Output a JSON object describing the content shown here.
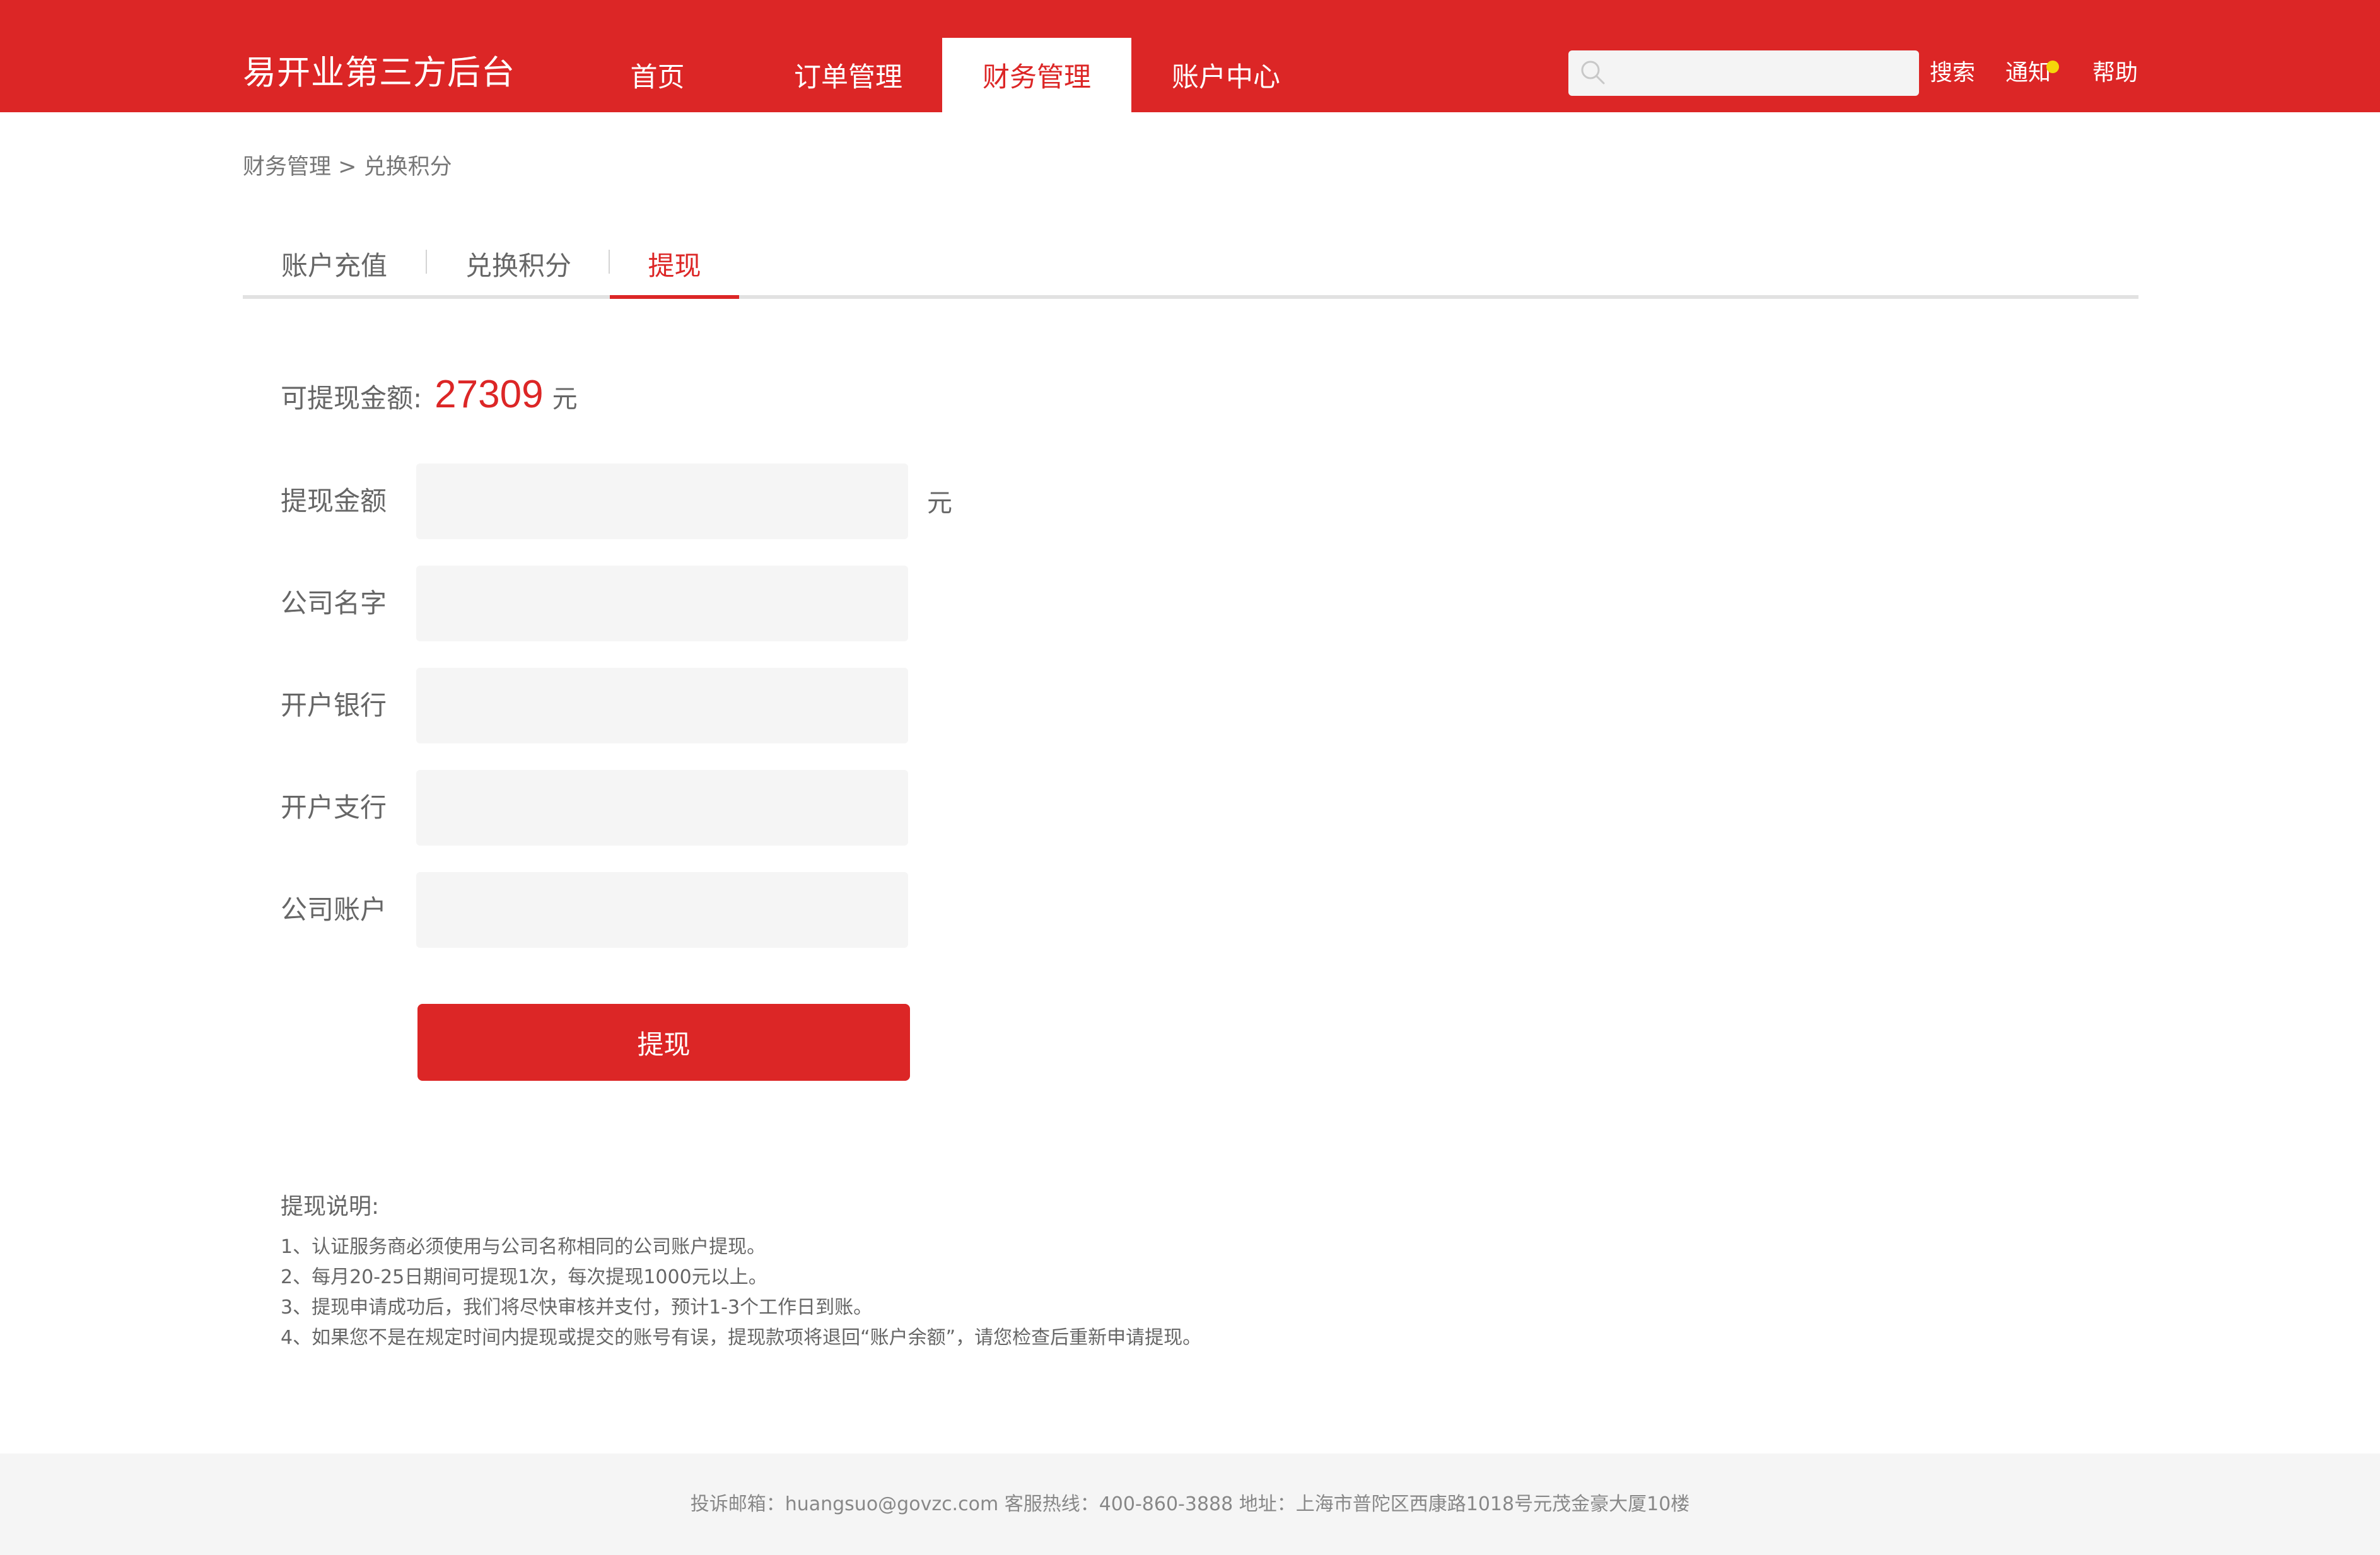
{
  "header": {
    "brand": "易开业第三方后台",
    "nav": [
      {
        "label": "首页",
        "active": false
      },
      {
        "label": "订单管理",
        "active": false
      },
      {
        "label": "财务管理",
        "active": true
      },
      {
        "label": "账户中心",
        "active": false
      }
    ],
    "search": {
      "placeholder": "",
      "value": "",
      "icon": "search-icon"
    },
    "search_label": "搜索",
    "notify_label": "通知",
    "help_label": "帮助",
    "accent_color": "#dc2626",
    "notify_dot_color": "#f5d70a"
  },
  "breadcrumb": "财务管理 > 兑换积分",
  "tabs": [
    {
      "label": "账户充值",
      "active": false
    },
    {
      "label": "兑换积分",
      "active": false
    },
    {
      "label": "提现",
      "active": true
    }
  ],
  "withdraw": {
    "available_label": "可提现金额:",
    "available_amount": "27309",
    "available_unit": "元",
    "fields": [
      {
        "label": "提现金额",
        "value": "",
        "suffix": "元"
      },
      {
        "label": "公司名字",
        "value": ""
      },
      {
        "label": "开户银行",
        "value": ""
      },
      {
        "label": "开户支行",
        "value": ""
      },
      {
        "label": "公司账户",
        "value": ""
      }
    ],
    "submit_label": "提现"
  },
  "notes": {
    "title": "提现说明:",
    "items": [
      "1、认证服务商必须使用与公司名称相同的公司账户提现。",
      "2、每月20-25日期间可提现1次，每次提现1000元以上。",
      "3、提现申请成功后，我们将尽快审核并支付，预计1-3个工作日到账。",
      "4、如果您不是在规定时间内提现或提交的账号有误，提现款项将退回“账户余额”，请您检查后重新申请提现。"
    ]
  },
  "footer": {
    "text": "投诉邮箱：huangsuo@govzc.com  客服热线：400-860-3888  地址：上海市普陀区西康路1018号元茂金豪大厦10楼"
  }
}
